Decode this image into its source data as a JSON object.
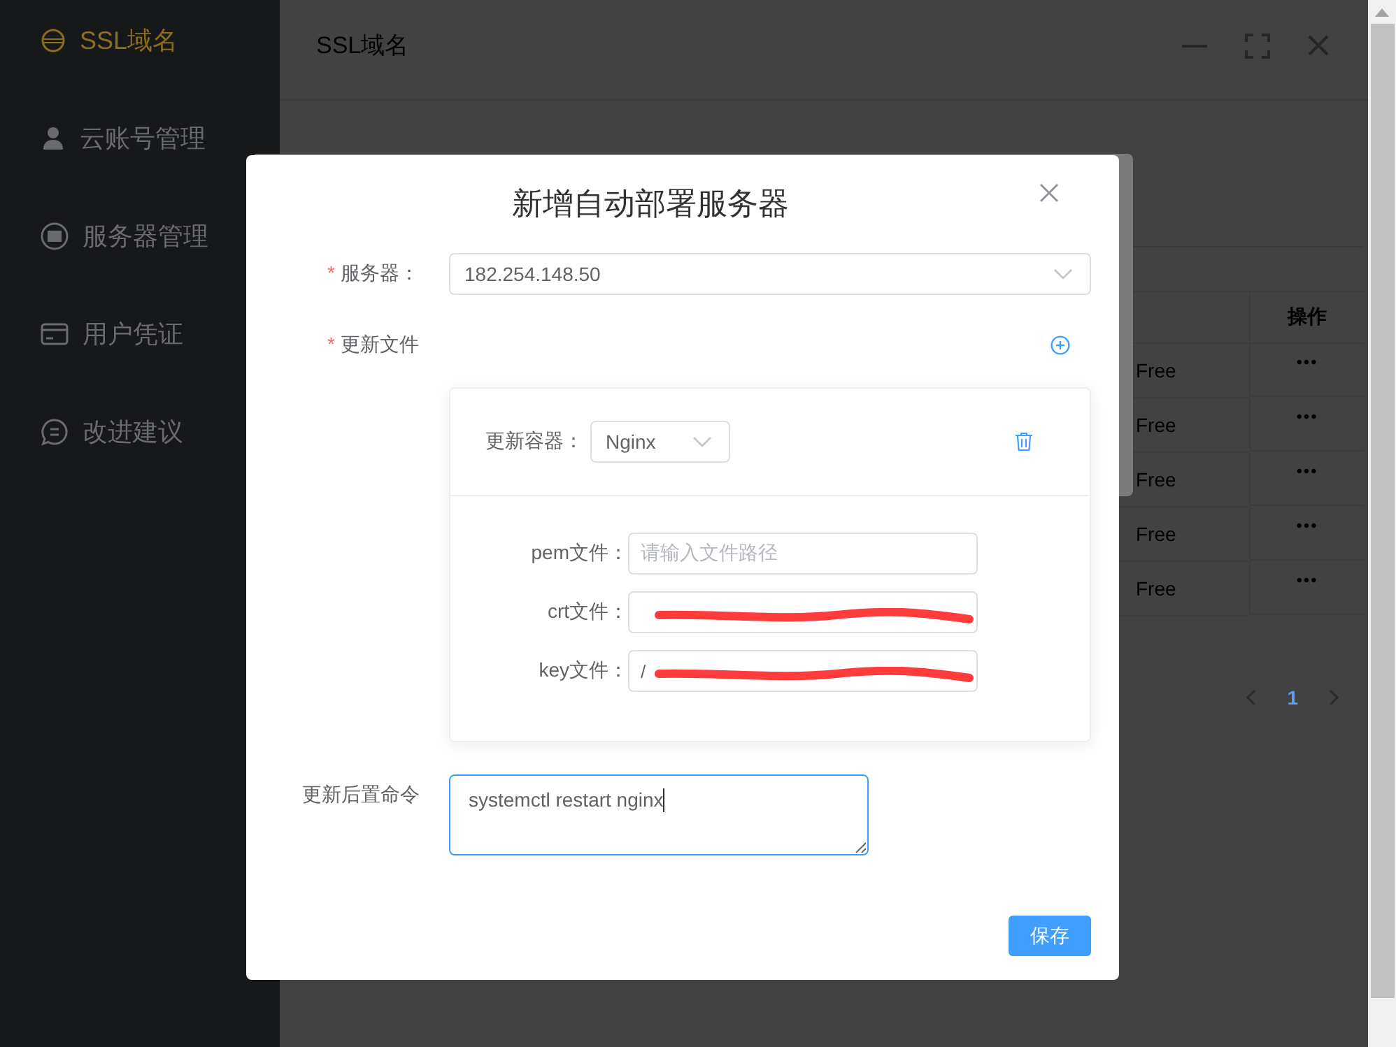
{
  "sidebar": {
    "items": [
      {
        "label": "SSL域名",
        "selected": true
      },
      {
        "label": "云账号管理",
        "selected": false
      },
      {
        "label": "服务器管理",
        "selected": false
      },
      {
        "label": "用户凭证",
        "selected": false
      },
      {
        "label": "改进建议",
        "selected": false
      }
    ]
  },
  "window": {
    "title": "SSL域名"
  },
  "table": {
    "columns": [
      "操作"
    ],
    "rows": [
      {
        "column_2": "Free",
        "actions": "•••"
      },
      {
        "column_2": "Free",
        "actions": "•••"
      },
      {
        "column_2": "Free",
        "actions": "•••"
      },
      {
        "column_2": "Free",
        "actions": "•••"
      },
      {
        "column_2": "Free",
        "actions": "•••"
      }
    ]
  },
  "pagination": {
    "pages": [
      {
        "label": "1",
        "selected": true
      }
    ]
  },
  "dialog": {
    "title": "新增自动部署服务器",
    "server": {
      "required_mark": "*",
      "label": "服务器：",
      "value": "182.254.148.50"
    },
    "files": {
      "required_mark": "*",
      "label": "更新文件",
      "items": [
        {
          "container": {
            "label": "更新容器：",
            "value": "Nginx"
          },
          "fields": [
            {
              "label": "pem文件：",
              "placeholder": "请输入文件路径",
              "redacted": false
            },
            {
              "label": "crt文件：",
              "redacted": true
            },
            {
              "label": "key文件：",
              "value": "/",
              "redacted": true
            }
          ]
        }
      ]
    },
    "command": {
      "label": "更新后置命令",
      "value": "systemctl restart nginx",
      "focused": true
    },
    "save_button": "保存"
  }
}
